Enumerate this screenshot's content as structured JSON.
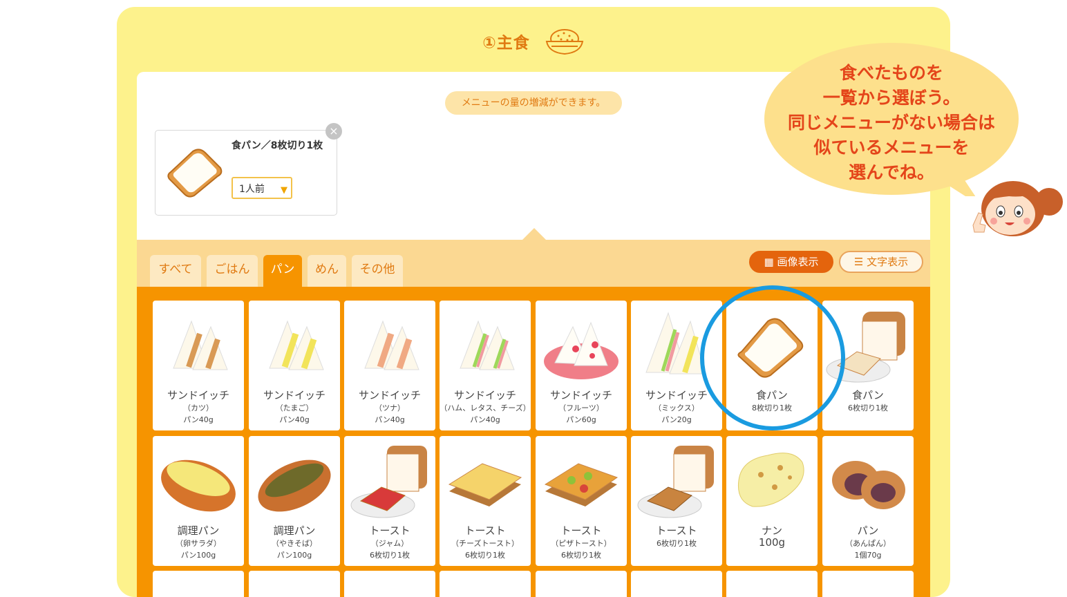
{
  "section": {
    "title": "①主食",
    "icon": "rice-bowl-icon"
  },
  "hint": "メニューの量の増減ができます。",
  "selected": {
    "name": "食パン／8枚切り1枚",
    "quantity": "1人前",
    "icon": "bread-slice-icon"
  },
  "tabs": [
    {
      "label": "すべて",
      "active": false
    },
    {
      "label": "ごはん",
      "active": false
    },
    {
      "label": "パン",
      "active": true
    },
    {
      "label": "めん",
      "active": false
    },
    {
      "label": "その他",
      "active": false
    }
  ],
  "view": {
    "image_label": "画像表示",
    "text_label": "文字表示"
  },
  "items": [
    {
      "name": "サンドイッチ",
      "detail": "（カツ）",
      "amount": "パン40g",
      "icon": "sandwich-katsu-icon"
    },
    {
      "name": "サンドイッチ",
      "detail": "（たまご）",
      "amount": "パン40g",
      "icon": "sandwich-egg-icon"
    },
    {
      "name": "サンドイッチ",
      "detail": "（ツナ）",
      "amount": "パン40g",
      "icon": "sandwich-tuna-icon"
    },
    {
      "name": "サンドイッチ",
      "detail": "（ハム、レタス、チーズ）",
      "amount": "パン40g",
      "icon": "sandwich-ham-icon"
    },
    {
      "name": "サンドイッチ",
      "detail": "（フルーツ）",
      "amount": "パン60g",
      "icon": "sandwich-fruit-icon"
    },
    {
      "name": "サンドイッチ",
      "detail": "（ミックス）",
      "amount": "パン20g",
      "icon": "sandwich-mix-icon"
    },
    {
      "name": "食パン",
      "detail": "8枚切り1枚",
      "amount": "",
      "icon": "bread-slice-icon"
    },
    {
      "name": "食パン",
      "detail": "6枚切り1枚",
      "amount": "",
      "icon": "bread-loaf-icon"
    },
    {
      "name": "調理パン",
      "detail": "（卵サラダ）",
      "amount": "パン100g",
      "icon": "egg-roll-icon"
    },
    {
      "name": "調理パン",
      "detail": "（やきそば）",
      "amount": "パン100g",
      "icon": "yakisoba-roll-icon"
    },
    {
      "name": "トースト",
      "detail": "（ジャム）",
      "amount": "6枚切り1枚",
      "icon": "jam-toast-icon"
    },
    {
      "name": "トースト",
      "detail": "（チーズトースト）",
      "amount": "6枚切り1枚",
      "icon": "cheese-toast-icon"
    },
    {
      "name": "トースト",
      "detail": "（ピザトースト）",
      "amount": "6枚切り1枚",
      "icon": "pizza-toast-icon"
    },
    {
      "name": "トースト",
      "detail": "6枚切り1枚",
      "amount": "",
      "icon": "toast-icon"
    },
    {
      "name": "ナン",
      "detail": "100g",
      "amount": "",
      "icon": "naan-icon"
    },
    {
      "name": "パン",
      "detail": "（あんぱん）",
      "amount": "1個70g",
      "icon": "anpan-icon"
    }
  ],
  "bubble": {
    "lines": [
      "食べたものを",
      "一覧から選ぼう。",
      "同じメニューがない場合は",
      "似ているメニューを",
      "選んでね。"
    ],
    "character": "girl-character-icon"
  },
  "colors": {
    "frame": "#fdf28c",
    "accent": "#f69400",
    "highlight": "#1a9be0"
  }
}
